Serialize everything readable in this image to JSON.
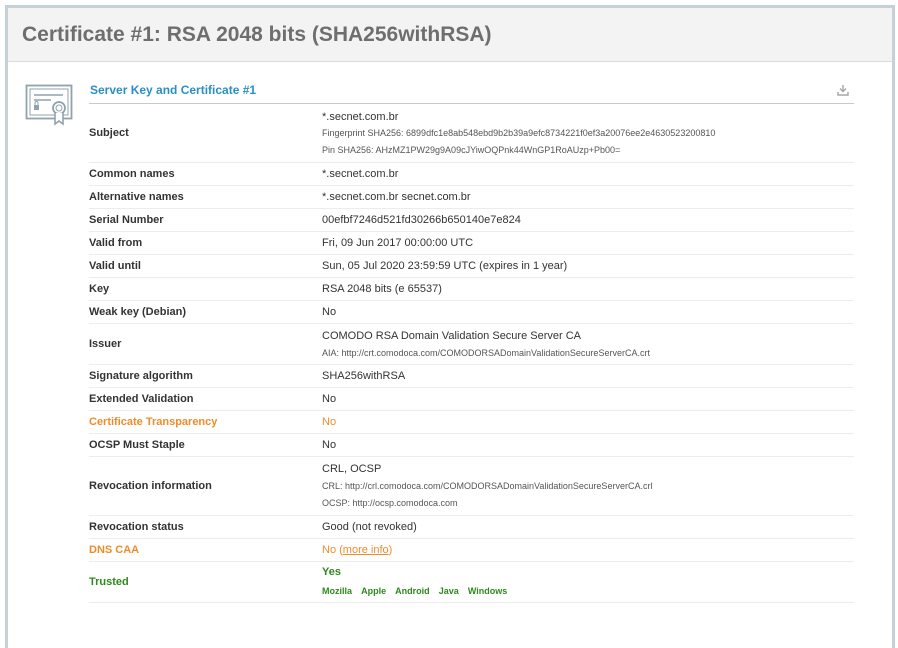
{
  "page": {
    "title": "Certificate #1: RSA 2048 bits (SHA256withRSA)"
  },
  "section": {
    "title": "Server Key and Certificate #1",
    "icon": "certificate-icon",
    "download_icon": "download-icon"
  },
  "rows": {
    "subject": {
      "label": "Subject",
      "value": "*.secnet.com.br",
      "fingerprint": "Fingerprint SHA256: 6899dfc1e8ab548ebd9b2b39a9efc8734221f0ef3a20076ee2e4630523200810",
      "pin": "Pin SHA256: AHzMZ1PW29g9A09cJYiwOQPnk44WnGP1RoAUzp+Pb00="
    },
    "common_names": {
      "label": "Common names",
      "value": "*.secnet.com.br"
    },
    "alt_names": {
      "label": "Alternative names",
      "value": "*.secnet.com.br secnet.com.br"
    },
    "serial": {
      "label": "Serial Number",
      "value": "00efbf7246d521fd30266b650140e7e824"
    },
    "valid_from": {
      "label": "Valid from",
      "value": "Fri, 09 Jun 2017 00:00:00 UTC"
    },
    "valid_until": {
      "label": "Valid until",
      "value": "Sun, 05 Jul 2020 23:59:59 UTC (expires in 1 year)"
    },
    "key": {
      "label": "Key",
      "value": "RSA 2048 bits (e 65537)"
    },
    "weak_key": {
      "label": "Weak key (Debian)",
      "value": "No"
    },
    "issuer": {
      "label": "Issuer",
      "value": "COMODO RSA Domain Validation Secure Server CA",
      "aia": "AIA: http://crt.comodoca.com/COMODORSADomainValidationSecureServerCA.crt"
    },
    "sig_alg": {
      "label": "Signature algorithm",
      "value": "SHA256withRSA"
    },
    "ev": {
      "label": "Extended Validation",
      "value": "No"
    },
    "ct": {
      "label": "Certificate Transparency",
      "value": "No"
    },
    "ocsp_staple": {
      "label": "OCSP Must Staple",
      "value": "No"
    },
    "revocation_info": {
      "label": "Revocation information",
      "value": "CRL, OCSP",
      "crl": "CRL: http://crl.comodoca.com/COMODORSADomainValidationSecureServerCA.crl",
      "ocsp": "OCSP: http://ocsp.comodoca.com"
    },
    "revocation_status": {
      "label": "Revocation status",
      "value": "Good (not revoked)"
    },
    "dns_caa": {
      "label": "DNS CAA",
      "value": "No",
      "paren_open": "(",
      "link": "more info",
      "paren_close": ")"
    },
    "trusted": {
      "label": "Trusted",
      "value": "Yes",
      "stores": [
        "Mozilla",
        "Apple",
        "Android",
        "Java",
        "Windows"
      ]
    }
  },
  "colors": {
    "accent_blue": "#2c8ec6",
    "warning_orange": "#ef8c2a",
    "trusted_green": "#2c8a1d"
  }
}
